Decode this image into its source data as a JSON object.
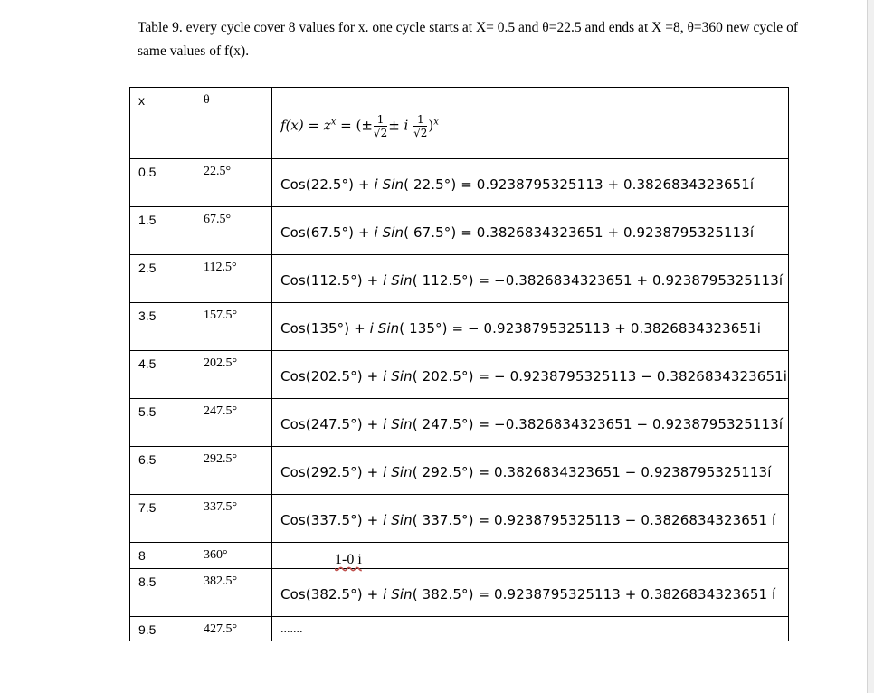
{
  "caption": "Table 9. every cycle cover 8 values for x. one cycle starts at X= 0.5 and θ=22.5 and ends at X =8, θ=360 new cycle of same values of f(x).",
  "header": {
    "x": "x",
    "theta": "θ",
    "formula_lhs": "f(x) = z",
    "formula_sup": "x",
    "formula_mid": "=  (±",
    "pm_i": "± i",
    "frac_num": "1",
    "frac_den": "√2",
    "formula_end": ")",
    "formula_end_sup": "x"
  },
  "rows": [
    {
      "x": "0.5",
      "theta": "22.5°",
      "cos_arg": "(22.5°)",
      "sin_arg": "( 22.5°)",
      "result": "= 0.9238795325113 + 0.3826834323651ı́"
    },
    {
      "x": "1.5",
      "theta": "67.5°",
      "cos_arg": "(67.5°)",
      "sin_arg": "( 67.5°)",
      "result": "= 0.3826834323651 + 0.9238795325113ı́"
    },
    {
      "x": "2.5",
      "theta": "112.5°",
      "cos_arg": "(112.5°)",
      "sin_arg": "( 112.5°)",
      "result": "= −0.3826834323651 + 0.9238795325113ı́"
    },
    {
      "x": "3.5",
      "theta": "157.5°",
      "cos_arg": "(135°)",
      "sin_arg": "( 135°)",
      "result": "= − 0.9238795325113 + 0.3826834323651i"
    },
    {
      "x": "4.5",
      "theta": "202.5°",
      "cos_arg": "(202.5°)",
      "sin_arg": "( 202.5°)",
      "result": "= − 0.9238795325113 −  0.3826834323651i"
    },
    {
      "x": "5.5",
      "theta": "247.5°",
      "cos_arg": "(247.5°)",
      "sin_arg": "( 247.5°)",
      "result": "= −0.3826834323651 −  0.9238795325113ı́"
    },
    {
      "x": "6.5",
      "theta": "292.5°",
      "cos_arg": "(292.5°)",
      "sin_arg": "( 292.5°)",
      "result": "= 0.3826834323651 −  0.9238795325113ı́"
    },
    {
      "x": "7.5",
      "theta": "337.5°",
      "cos_arg": "(337.5°)",
      "sin_arg": "( 337.5°)",
      "result": "= 0.9238795325113 − 0.3826834323651 ı́"
    },
    {
      "x": "8",
      "theta": "360°",
      "plain": "1-0 i"
    },
    {
      "x": "8.5",
      "theta": "382.5°",
      "cos_arg": "(382.5°)",
      "sin_arg": "( 382.5°)",
      "result": "= 0.9238795325113 + 0.3826834323651 ı́"
    },
    {
      "x": "9.5",
      "theta": "427.5°",
      "plain_dots": "......."
    }
  ],
  "labels": {
    "cos": "Cos",
    "plus_i": " + ",
    "i": "i",
    "sin": "Sin"
  }
}
